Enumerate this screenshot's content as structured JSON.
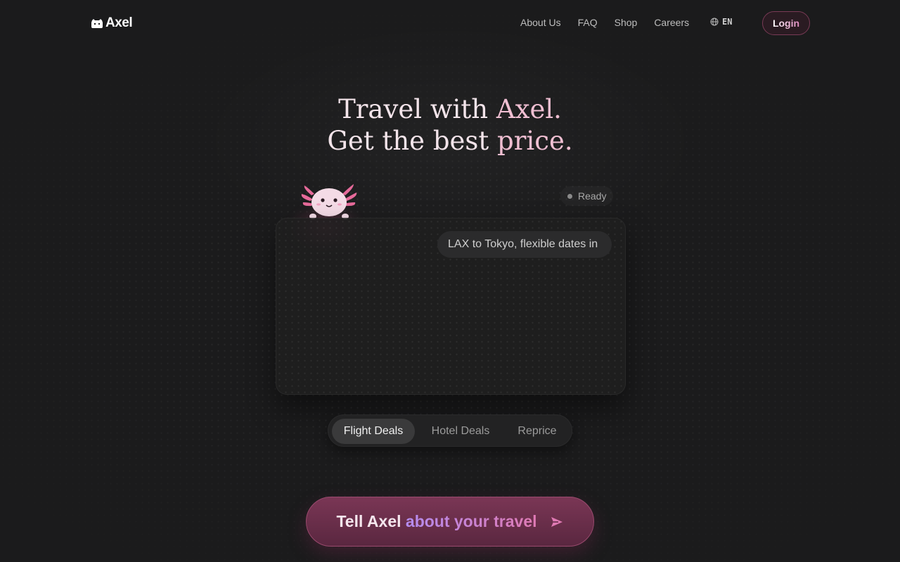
{
  "header": {
    "logo_text": "Axel",
    "nav": [
      "About Us",
      "FAQ",
      "Shop",
      "Careers"
    ],
    "language": "EN",
    "login_label": "Login"
  },
  "hero": {
    "line1_a": "Travel with ",
    "line1_b": "Axel.",
    "line2_a": "Get the best ",
    "line2_b": "price."
  },
  "status": {
    "text": "Ready"
  },
  "chat": {
    "bubble_text": "LAX to Tokyo, flexible dates in"
  },
  "tabs": [
    "Flight Deals",
    "Hotel Deals",
    "Reprice"
  ],
  "active_tab": "Flight Deals",
  "cta": {
    "part1": "Tell Axel",
    "part2": "about your travel"
  },
  "colors": {
    "accent": "#e07ab4",
    "accent2": "#b48cf0",
    "bg": "#1b1b1c"
  },
  "icons": {
    "logo": "axolotl-logo-icon",
    "language": "globe-icon",
    "send": "send-icon"
  }
}
